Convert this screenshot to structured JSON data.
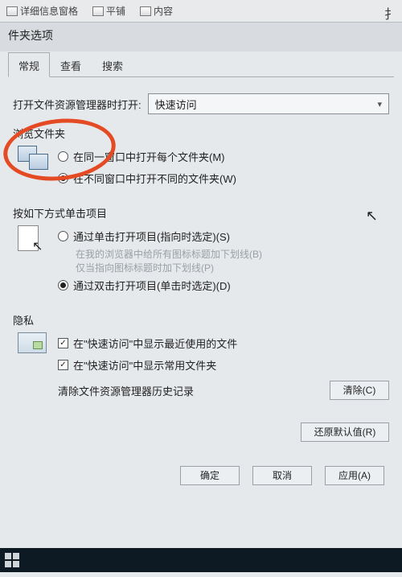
{
  "toolbar": {
    "item1": "详细信息窗格",
    "item2": "平铺",
    "item3": "内容",
    "cutoff": "扌"
  },
  "dialog_title": "件夹选项",
  "tabs": {
    "t1": "常规",
    "t2": "查看",
    "t3": "搜索"
  },
  "open_with": {
    "label": "打开文件资源管理器时打开:",
    "value": "快速访问"
  },
  "browse": {
    "heading": "浏览文件夹",
    "opt1": "在同一窗口中打开每个文件夹(M)",
    "opt2": "在不同窗口中打开不同的文件夹(W)"
  },
  "click": {
    "heading": "按如下方式单击项目",
    "opt1": "通过单击打开项目(指向时选定)(S)",
    "sub1": "在我的浏览器中给所有图标标题加下划线(B)",
    "sub2": "仅当指向图标标题时加下划线(P)",
    "opt2": "通过双击打开项目(单击时选定)(D)"
  },
  "privacy": {
    "heading": "隐私",
    "c1": "在\"快速访问\"中显示最近使用的文件",
    "c2": "在\"快速访问\"中显示常用文件夹",
    "clear_label": "清除文件资源管理器历史记录",
    "clear_btn": "清除(C)"
  },
  "restore_btn": "还原默认值(R)",
  "footer": {
    "ok": "确定",
    "cancel": "取消",
    "apply": "应用(A)"
  }
}
